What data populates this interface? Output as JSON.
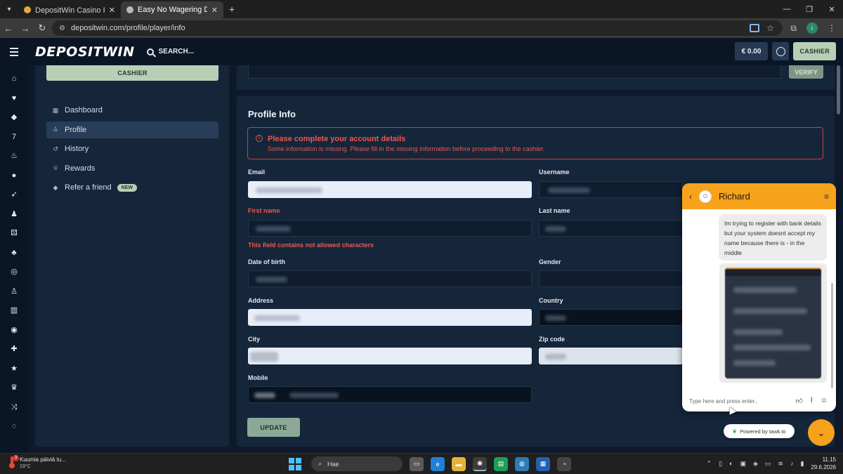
{
  "browser": {
    "tabs": [
      {
        "title": "DepositWin Casino Review ⊳ E",
        "active": false
      },
      {
        "title": "Easy No Wagering Deposit Cry",
        "active": true
      }
    ],
    "url": "depositwin.com/profile/player/info",
    "profile_initial": "i"
  },
  "header": {
    "logo": "DEPOSITWIN",
    "search_label": "SEARCH...",
    "balance": "€ 0.00",
    "cashier_label": "CASHIER"
  },
  "sidebar": {
    "cashier_label": "CASHIER",
    "items": [
      {
        "label": "Dashboard",
        "icon": "grid-icon",
        "active": false
      },
      {
        "label": "Profile",
        "icon": "user-icon",
        "active": true
      },
      {
        "label": "History",
        "icon": "history-icon",
        "active": false
      },
      {
        "label": "Rewards",
        "icon": "trophy-icon",
        "active": false
      },
      {
        "label": "Refer a friend",
        "icon": "diamond-icon",
        "active": false,
        "badge": "NEW"
      }
    ]
  },
  "verify": {
    "button_label": "VERIFY"
  },
  "profile": {
    "title": "Profile Info",
    "alert_title": "Please complete your account details",
    "alert_body": "Some information is missing. Please fill in the missing information before proceeding to the cashier.",
    "fields": {
      "email": "Email",
      "username": "Username",
      "first_name": "First name",
      "last_name": "Last name",
      "first_name_error": "This field contains not allowed characters",
      "dob": "Date of birth",
      "gender": "Gender",
      "address": "Address",
      "country": "Country",
      "city": "City",
      "zip": "Zip code",
      "mobile": "Mobile"
    },
    "update_label": "UPDATE"
  },
  "chat": {
    "agent_name": "Richard",
    "message": "Im trying to register with bank details but your system doesnt accept my name because there is - in the middle",
    "input_placeholder": "Type here and press enter..",
    "powered_by": "Powered by tawk.to"
  },
  "taskbar": {
    "weather_title": "Kuumia päiviä tu...",
    "weather_temp": "19°C",
    "weather_badge": "3",
    "search_label": "Hae",
    "time": "11.15",
    "date": "29.6.2026"
  }
}
